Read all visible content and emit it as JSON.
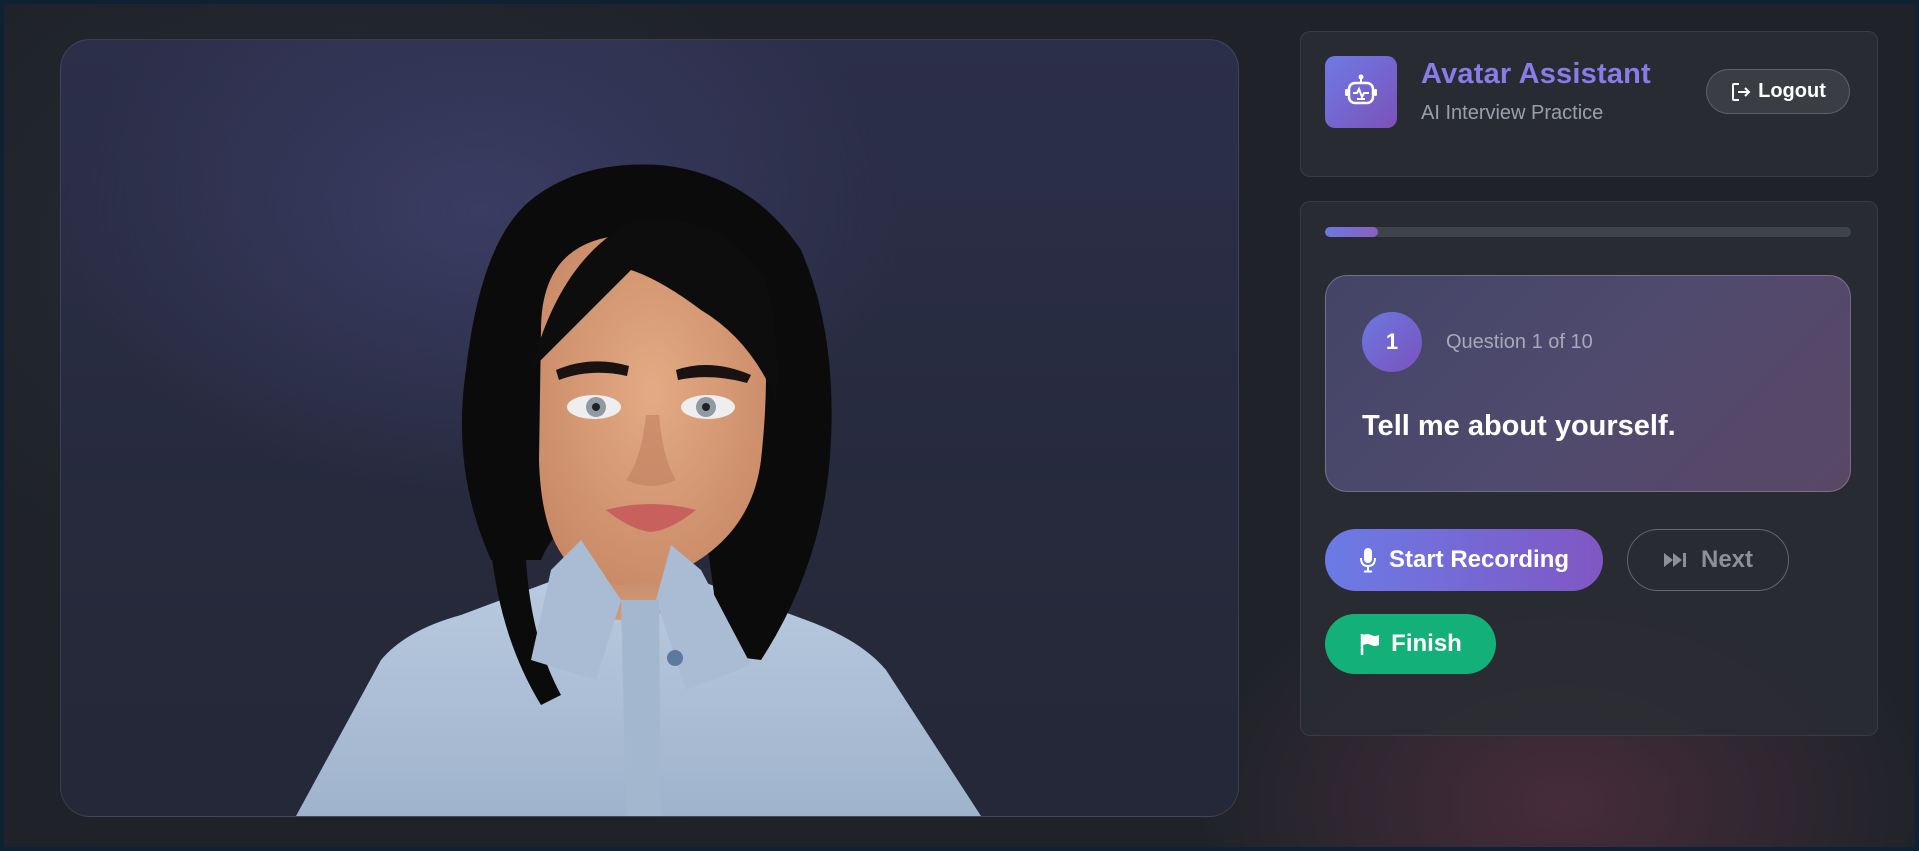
{
  "app": {
    "title": "Avatar Assistant",
    "subtitle": "AI Interview Practice",
    "logo_icon": "robot-icon",
    "logout_label": "Logout",
    "logout_icon": "logout-icon"
  },
  "progress": {
    "value": 0.1,
    "color_start": "#6c78e0",
    "color_end": "#8a5fc0"
  },
  "question": {
    "number": "1",
    "meta": "Question 1 of 10",
    "text": "Tell me about yourself."
  },
  "actions": {
    "record_label": "Start Recording",
    "record_icon": "microphone-icon",
    "next_label": "Next",
    "next_icon": "fast-forward-icon",
    "finish_label": "Finish",
    "finish_icon": "flag-icon"
  },
  "colors": {
    "accent": "#7b6fe0",
    "finish": "#14b07a",
    "background": "#1f2329"
  }
}
